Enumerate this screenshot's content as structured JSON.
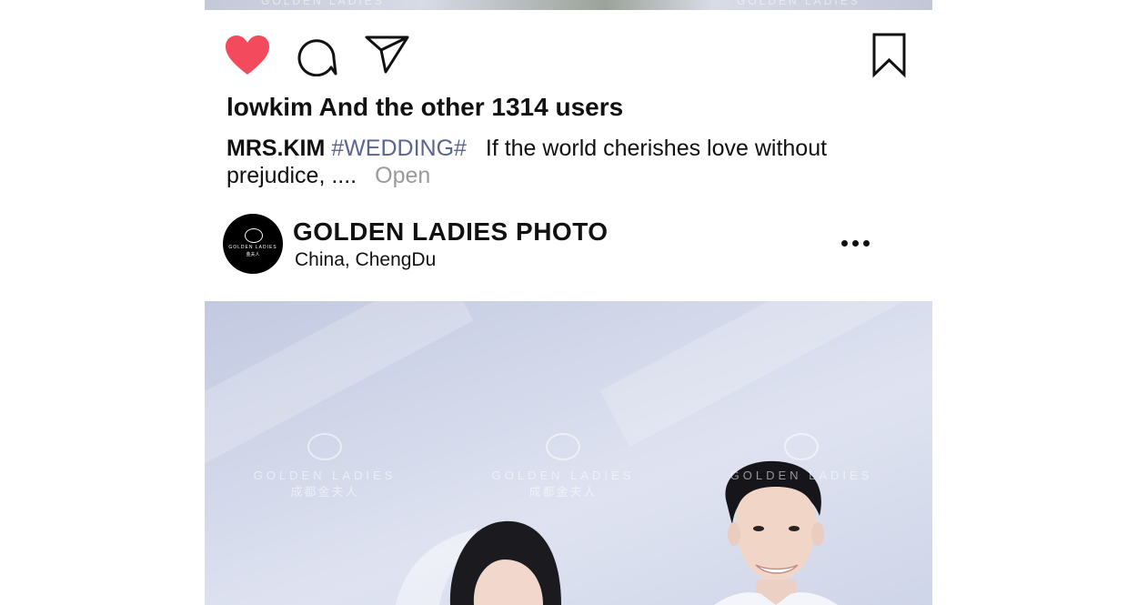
{
  "post": {
    "previous_photo": {
      "watermark_text": "GOLDEN LADIES"
    },
    "actions": {
      "like_icon": "heart-filled-icon",
      "like_color": "#f44a5e",
      "comment_icon": "comment-bubble-icon",
      "share_icon": "paper-plane-icon",
      "save_icon": "bookmark-icon"
    },
    "likes_text": "lowkim And the other 1314 users",
    "caption": {
      "author": "MRS.KIM",
      "hashtag": "#WEDDING#",
      "text": "If the world cherishes love without prejudice, ....",
      "more_label": "Open",
      "hashtag_color": "#5b6591"
    }
  },
  "next_post": {
    "avatar": {
      "logo_text": "GOLDEN LADIES",
      "logo_subtext": "金夫人"
    },
    "account_name": "GOLDEN LADIES PHOTO",
    "location": {
      "country": "China,",
      "city": "ChengDu"
    },
    "more_icon": "more-horizontal-icon",
    "photo": {
      "watermarks": [
        {
          "line1": "GOLDEN LADIES",
          "line2": "成都金夫人"
        },
        {
          "line1": "GOLDEN LADIES",
          "line2": "成都金夫人"
        },
        {
          "line1": "GOLDEN LADIES",
          "line2": ""
        }
      ]
    }
  }
}
